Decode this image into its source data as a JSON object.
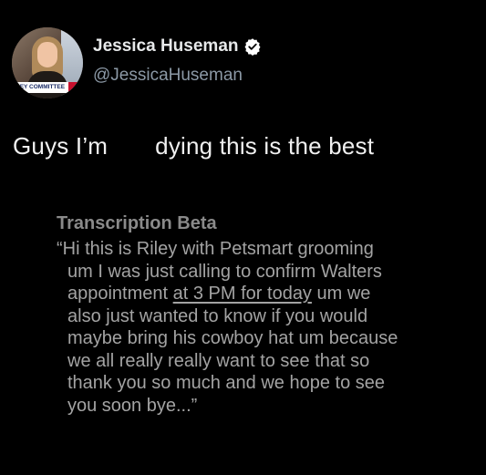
{
  "author": {
    "name": "Jessica Huseman",
    "handle": "@JessicaHuseman",
    "avatar_ribbon_text": "KEY COMMITTEE",
    "verified": true,
    "verified_color": "#ffffff"
  },
  "tweet": {
    "text_before": "Guys I’m",
    "text_after": "dying this is the best"
  },
  "transcription": {
    "heading": "Transcription Beta",
    "lines": [
      "“Hi this is Riley with Petsmart grooming",
      "um I was just calling to confirm Walters",
      "also just wanted to know if you would",
      "maybe bring his cowboy hat um because",
      "we all really really want to see that so",
      "thank you so much and we hope to see",
      "you soon bye...”"
    ],
    "line3_before": "appointment ",
    "line3_link": "at 3 PM for today",
    "line3_after": " um we"
  },
  "colors": {
    "background": "#000000",
    "name": "#e7e9ea",
    "handle": "#8b98a5",
    "transcription_text": "#a3a3a3",
    "transcription_heading": "#8a8a8a"
  }
}
